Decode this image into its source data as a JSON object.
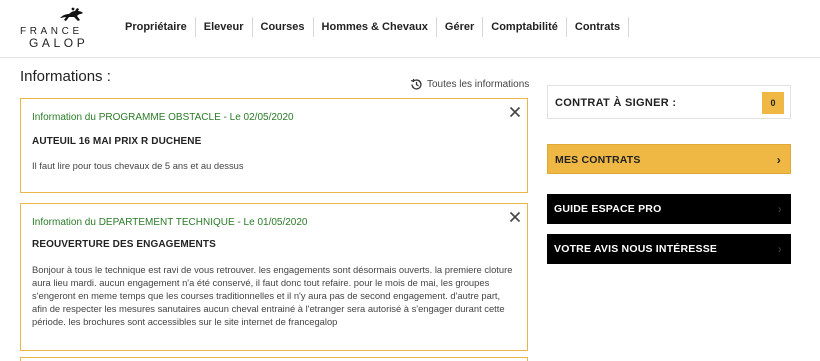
{
  "header": {
    "logo_line1": "FRANCE",
    "logo_line2": "GALOP",
    "nav": [
      "Propriétaire",
      "Eleveur",
      "Courses",
      "Hommes & Chevaux",
      "Gérer",
      "Comptabilité",
      "Contrats"
    ]
  },
  "main": {
    "title": "Informations :",
    "all_info_link": "Toutes les informations",
    "cards": [
      {
        "heading": "Information du PROGRAMME OBSTACLE - Le 02/05/2020",
        "title": "AUTEUIL 16 MAI PRIX R DUCHENE",
        "body": "Il faut lire pour tous chevaux de 5 ans et au dessus"
      },
      {
        "heading": "Information du DEPARTEMENT TECHNIQUE - Le 01/05/2020",
        "title": "REOUVERTURE DES ENGAGEMENTS",
        "body": "Bonjour à tous le technique est ravi de vous retrouver. les engagements sont désormais ouverts. la premiere cloture aura lieu mardi. aucun engagement n'a été conservé, il faut donc tout refaire. pour le mois de mai, les groupes s'engeront en meme temps que les courses traditionnelles et il n'y aura pas de second engagement. d'autre part, afin de respecter les mesures sanutaires aucun cheval entrainé à l'etranger sera autorisé à s'engager durant cette période. les brochures sont accessibles sur le site internet de francegalop"
      }
    ]
  },
  "sidebar": {
    "contract_label": "CONTRAT À SIGNER :",
    "contract_count": "0",
    "mes_contrats": "MES CONTRATS",
    "guide": "GUIDE ESPACE PRO",
    "avis": "VOTRE AVIS NOUS INTÉRESSE",
    "chevron": "›"
  },
  "colors": {
    "accent_gold": "#efb845",
    "green_heading": "#2a7a28",
    "dark_button": "#000000"
  }
}
